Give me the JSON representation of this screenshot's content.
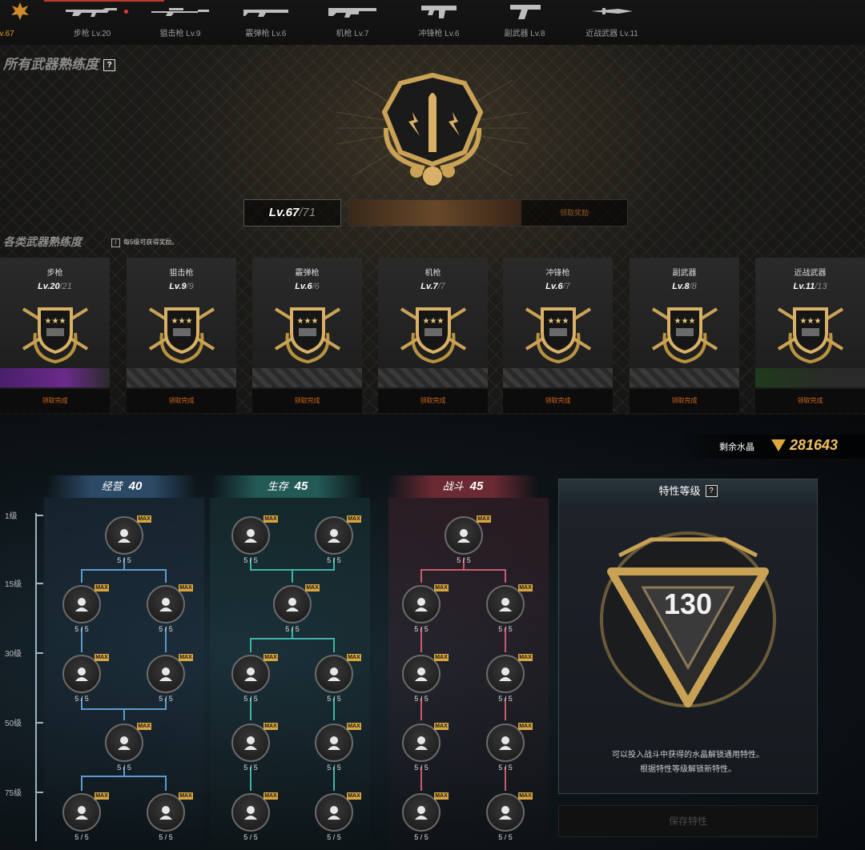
{
  "tabs": [
    {
      "label": "Lv.67",
      "icon": "weapon-mastery-icon"
    },
    {
      "label": "步枪 Lv.20",
      "icon": "rifle-icon"
    },
    {
      "label": "狙击枪 Lv.9",
      "icon": "sniper-icon"
    },
    {
      "label": "霰弹枪 Lv.6",
      "icon": "shotgun-icon"
    },
    {
      "label": "机枪 Lv.7",
      "icon": "machinegun-icon"
    },
    {
      "label": "冲锋枪 Lv.6",
      "icon": "smg-icon"
    },
    {
      "label": "副武器 Lv.8",
      "icon": "pistol-icon"
    },
    {
      "label": "近战武器 Lv.11",
      "icon": "knife-icon"
    }
  ],
  "all_mastery": {
    "title": "所有武器熟练度",
    "help": "?",
    "level": "Lv.67",
    "level_max": "/71",
    "progress": 0.62,
    "claim_label": "领取奖励"
  },
  "category_mastery": {
    "title": "各类武器熟练度",
    "hint": "每5级可获得奖励。",
    "hint_icon": "!"
  },
  "cards": [
    {
      "name": "步枪",
      "level": "Lv.20",
      "max": "/21",
      "claim": "领取完成",
      "strip": "purple"
    },
    {
      "name": "狙击枪",
      "level": "Lv.9",
      "max": "/9",
      "claim": "领取完成",
      "strip": "grey"
    },
    {
      "name": "霰弹枪",
      "level": "Lv.6",
      "max": "/6",
      "claim": "领取完成",
      "strip": "grey"
    },
    {
      "name": "机枪",
      "level": "Lv.7",
      "max": "/7",
      "claim": "领取完成",
      "strip": "grey"
    },
    {
      "name": "冲锋枪",
      "level": "Lv.6",
      "max": "/7",
      "claim": "领取完成",
      "strip": "grey"
    },
    {
      "name": "副武器",
      "level": "Lv.8",
      "max": "/8",
      "claim": "领取完成",
      "strip": "grey"
    },
    {
      "name": "近战武器",
      "level": "Lv.11",
      "max": "/13",
      "claim": "领取完成",
      "strip": "green"
    }
  ],
  "crystal": {
    "label": "剩余水晶",
    "value": "281643"
  },
  "trait_columns": [
    {
      "name": "经营",
      "value": "40",
      "color": "#5d9bd0"
    },
    {
      "name": "生存",
      "value": "45",
      "color": "#3fb3aa"
    },
    {
      "name": "战斗",
      "value": "45",
      "color": "#c85c6c"
    }
  ],
  "levels": [
    "1级",
    "15级",
    "30级",
    "50级",
    "75级"
  ],
  "node_count": "5 / 5",
  "max_badge": "MAX",
  "trait_panel": {
    "title": "特性等级",
    "help": "?",
    "level": "130",
    "desc1": "可以投入战斗中获得的水晶解锁通用特性。",
    "desc2": "根据特性等级解锁新特性。"
  },
  "save_label": "保存特性"
}
